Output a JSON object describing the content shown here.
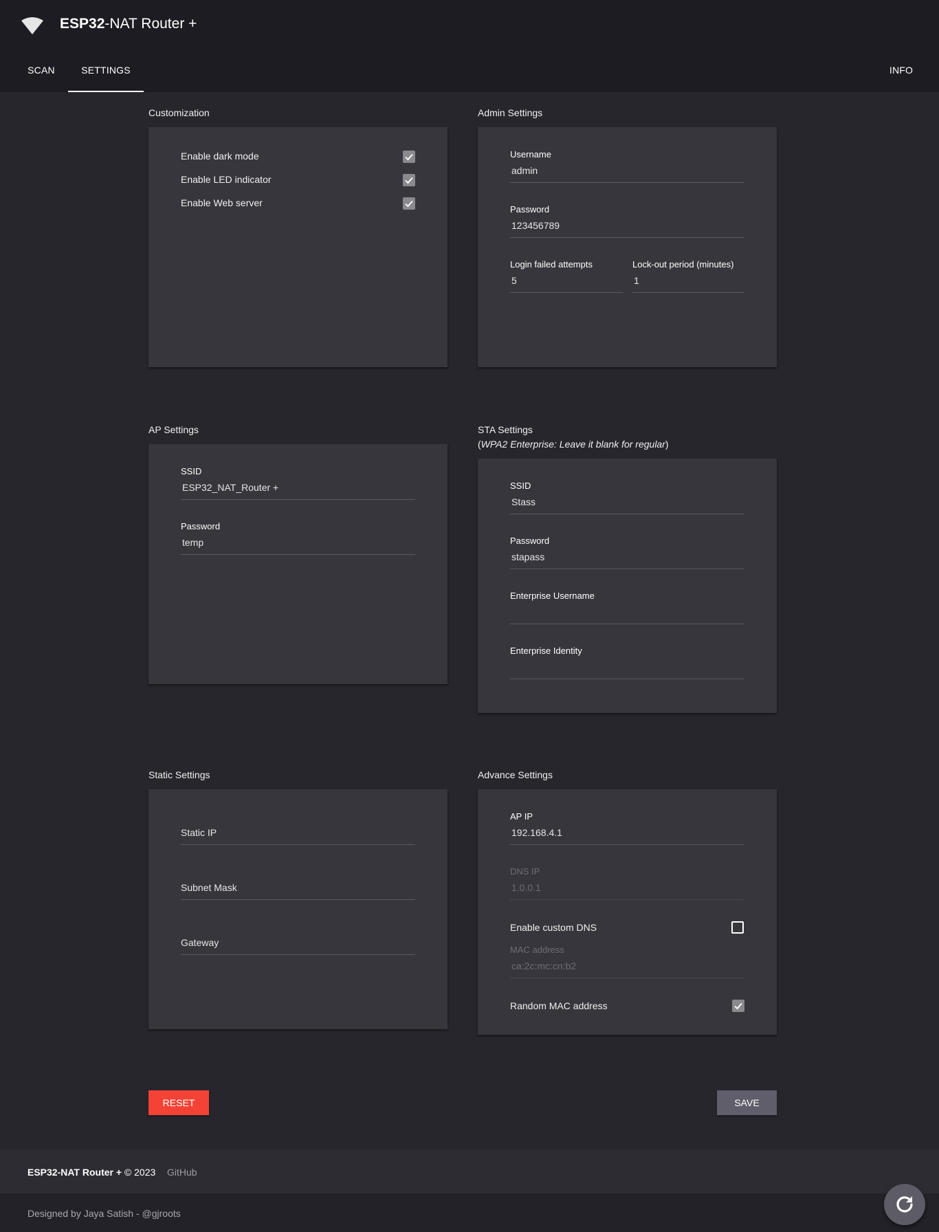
{
  "header": {
    "title_bold": "ESP32",
    "title_rest": "-NAT Router +",
    "logo_icon": "wifi-icon"
  },
  "nav": {
    "tabs": [
      {
        "label": "SCAN",
        "active": false
      },
      {
        "label": "SETTINGS",
        "active": true
      }
    ],
    "right_tab": "INFO"
  },
  "customization": {
    "title": "Customization",
    "options": [
      {
        "label": "Enable dark mode",
        "checked": true
      },
      {
        "label": "Enable LED indicator",
        "checked": true
      },
      {
        "label": "Enable Web server",
        "checked": true
      }
    ]
  },
  "admin": {
    "title": "Admin Settings",
    "username_label": "Username",
    "username_value": "admin",
    "password_label": "Password",
    "password_value": "123456789",
    "attempts_label": "Login failed attempts",
    "attempts_value": "5",
    "lockout_label": "Lock-out period (minutes)",
    "lockout_value": "1"
  },
  "ap": {
    "title": "AP Settings",
    "ssid_label": "SSID",
    "ssid_value": "ESP32_NAT_Router +",
    "password_label": "Password",
    "password_value": "temp"
  },
  "sta": {
    "title": "STA Settings",
    "note_open": "(",
    "note_italic": "WPA2 Enterprise: Leave it blank for regular",
    "note_close": ")",
    "ssid_label": "SSID",
    "ssid_value": "Stass",
    "password_label": "Password",
    "password_value": "stapass",
    "ent_user_label": "Enterprise Username",
    "ent_user_value": "",
    "ent_identity_label": "Enterprise Identity",
    "ent_identity_value": ""
  },
  "static": {
    "title": "Static Settings",
    "ip_placeholder": "Static IP",
    "subnet_placeholder": "Subnet Mask",
    "gateway_placeholder": "Gateway"
  },
  "advance": {
    "title": "Advance Settings",
    "ap_ip_label": "AP IP",
    "ap_ip_value": "192.168.4.1",
    "dns_label": "DNS IP",
    "dns_value": "1.0.0.1",
    "custom_dns_label": "Enable custom DNS",
    "custom_dns_checked": false,
    "mac_label": "MAC address",
    "mac_value": "ca:2c:mc:cn:b2",
    "random_mac_label": "Random MAC address",
    "random_mac_checked": true
  },
  "actions": {
    "reset_label": "RESET",
    "save_label": "SAVE"
  },
  "footer": {
    "brand": "ESP32-NAT Router +",
    "copyright": " © 2023",
    "github_label": "GitHub",
    "credit": "Designed by Jaya Satish - @gjroots"
  },
  "colors": {
    "background": "#27262d",
    "header": "#1d1c22",
    "card": "#37363c",
    "reset": "#f44336",
    "save": "#5f5e6a"
  }
}
